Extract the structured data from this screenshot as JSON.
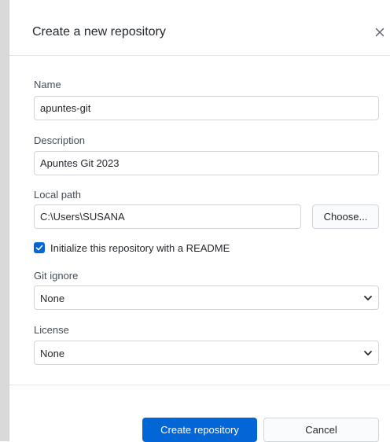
{
  "dialog": {
    "title": "Create a new repository",
    "close_icon": "close-icon"
  },
  "form": {
    "name": {
      "label": "Name",
      "value": "apuntes-git"
    },
    "description": {
      "label": "Description",
      "value": "Apuntes Git 2023"
    },
    "local_path": {
      "label": "Local path",
      "value": "C:\\Users\\SUSANA",
      "choose_label": "Choose..."
    },
    "readme": {
      "label": "Initialize this repository with a README",
      "checked": true
    },
    "git_ignore": {
      "label": "Git ignore",
      "selected": "None"
    },
    "license": {
      "label": "License",
      "selected": "None"
    }
  },
  "footer": {
    "create_label": "Create repository",
    "cancel_label": "Cancel"
  },
  "colors": {
    "accent": "#0366d6",
    "border": "#d1d5da",
    "divider": "#e1e4e8"
  }
}
